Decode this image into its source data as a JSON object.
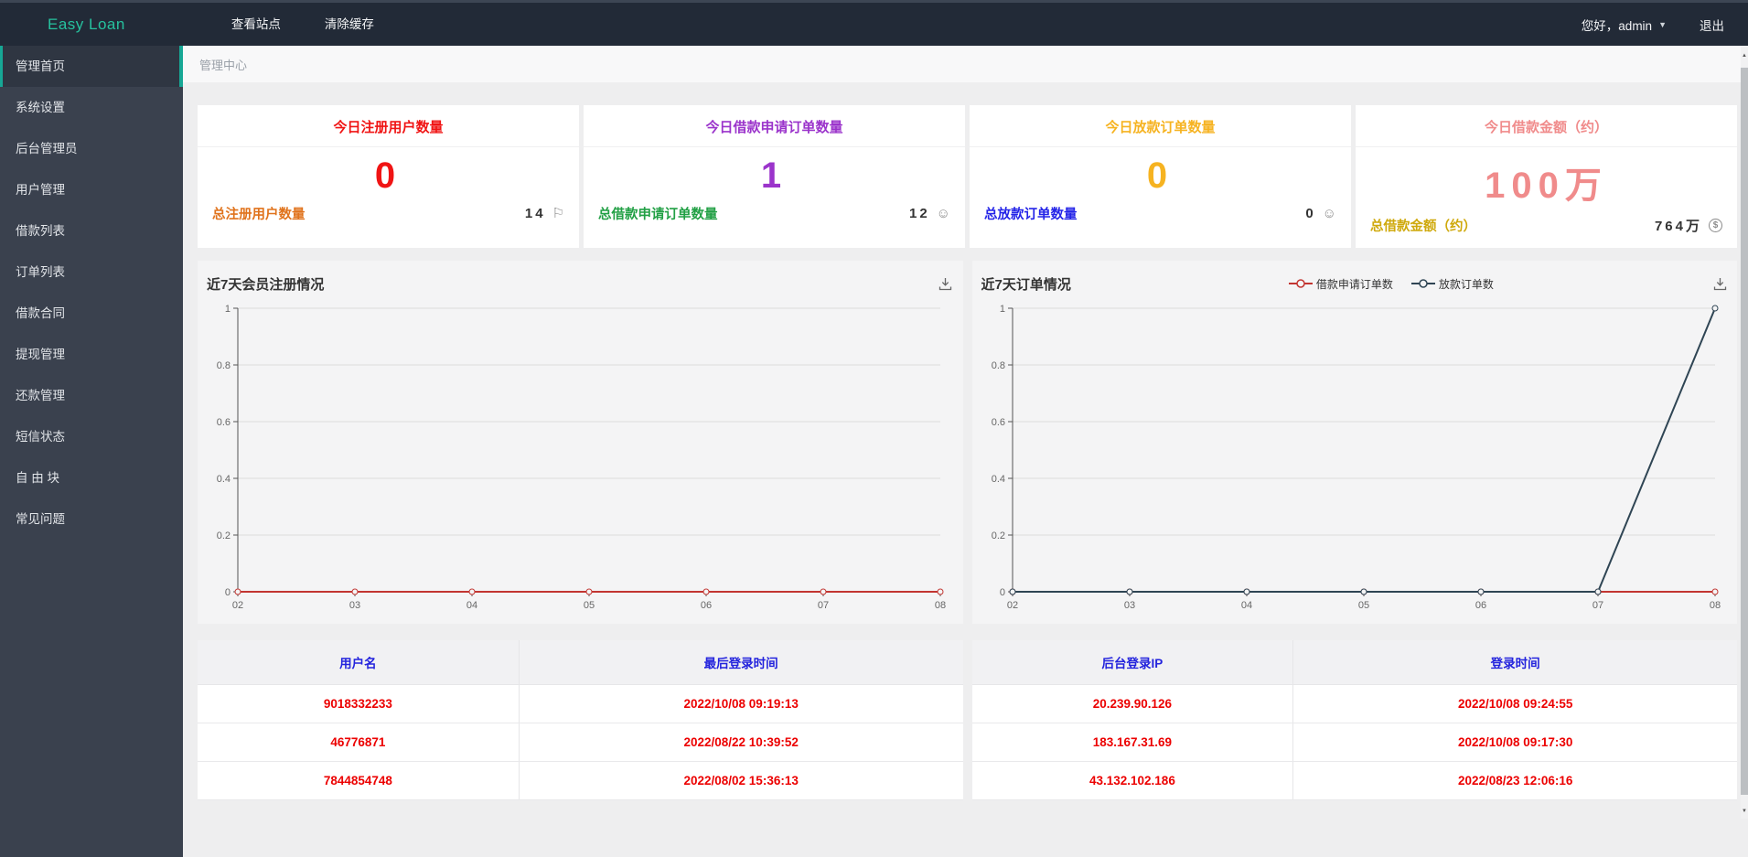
{
  "navbar": {
    "brand": "Easy Loan",
    "items": [
      {
        "label": "查看站点"
      },
      {
        "label": "清除缓存"
      }
    ],
    "greeting": "您好，admin",
    "logout": "退出"
  },
  "sidebar": {
    "items": [
      {
        "label": "管理首页",
        "active": true
      },
      {
        "label": "系统设置",
        "active": false
      },
      {
        "label": "后台管理员",
        "active": false
      },
      {
        "label": "用户管理",
        "active": false
      },
      {
        "label": "借款列表",
        "active": false
      },
      {
        "label": "订单列表",
        "active": false
      },
      {
        "label": "借款合同",
        "active": false
      },
      {
        "label": "提现管理",
        "active": false
      },
      {
        "label": "还款管理",
        "active": false
      },
      {
        "label": "短信状态",
        "active": false
      },
      {
        "label": "自 由 块",
        "active": false
      },
      {
        "label": "常见问题",
        "active": false
      }
    ]
  },
  "breadcrumb": "管理中心",
  "cards": [
    {
      "title": "今日注册用户数量",
      "color": "#f01414",
      "value": "0",
      "footer_label": "总注册用户数量",
      "footer_label_color": "#e0731c",
      "footer_value": "14",
      "footer_icon": "flag"
    },
    {
      "title": "今日借款申请订单数量",
      "color": "#9b34cb",
      "value": "1",
      "footer_label": "总借款申请订单数量",
      "footer_label_color": "#22a045",
      "footer_value": "12",
      "footer_icon": "smiley"
    },
    {
      "title": "今日放款订单数量",
      "color": "#f6b321",
      "value": "0",
      "footer_label": "总放款订单数量",
      "footer_label_color": "#2424e8",
      "footer_value": "0",
      "footer_icon": "smiley"
    },
    {
      "title": "今日借款金额（约）",
      "color": "#f08b8b",
      "value": "100万",
      "footer_label": "总借款金额（约）",
      "footer_label_color": "#cfa90c",
      "footer_value": "764万",
      "footer_icon": "dollar"
    }
  ],
  "chart_data": [
    {
      "type": "line",
      "title": "近7天会员注册情况",
      "categories": [
        "02",
        "03",
        "04",
        "05",
        "06",
        "07",
        "08"
      ],
      "series": [
        {
          "color": "#c23531",
          "values": [
            0,
            0,
            0,
            0,
            0,
            0,
            0
          ]
        }
      ],
      "xlabel": "",
      "ylabel": "",
      "ylim": [
        0,
        1
      ],
      "yticks": [
        0,
        0.2,
        0.4,
        0.6,
        0.8,
        1
      ],
      "grid": true,
      "legend_visible": false,
      "legend_position": "top-center"
    },
    {
      "type": "line",
      "title": "近7天订单情况",
      "categories": [
        "02",
        "03",
        "04",
        "05",
        "06",
        "07",
        "08"
      ],
      "series": [
        {
          "name": "借款申请订单数",
          "color": "#c23531",
          "values": [
            0,
            0,
            0,
            0,
            0,
            0,
            0
          ]
        },
        {
          "name": "放款订单数",
          "color": "#2f4554",
          "values": [
            0,
            0,
            0,
            0,
            0,
            0,
            1
          ]
        }
      ],
      "xlabel": "",
      "ylabel": "",
      "ylim": [
        0,
        1
      ],
      "yticks": [
        0,
        0.2,
        0.4,
        0.6,
        0.8,
        1
      ],
      "grid": true,
      "legend_visible": true,
      "legend_position": "top-center"
    }
  ],
  "tables": [
    {
      "headers": [
        "用户名",
        "最后登录时间"
      ],
      "rows": [
        [
          "9018332233",
          "2022/10/08 09:19:13"
        ],
        [
          "46776871",
          "2022/08/22 10:39:52"
        ],
        [
          "7844854748",
          "2022/08/02 15:36:13"
        ]
      ]
    },
    {
      "headers": [
        "后台登录IP",
        "登录时间"
      ],
      "rows": [
        [
          "20.239.90.126",
          "2022/10/08 09:24:55"
        ],
        [
          "183.167.31.69",
          "2022/10/08 09:17:30"
        ],
        [
          "43.132.102.186",
          "2022/08/23 12:06:16"
        ]
      ]
    }
  ],
  "colors": {
    "brand_teal": "#17a795",
    "navbar_bg": "#222a37",
    "sidebar_bg": "#3a414e",
    "series_red": "#c23531",
    "series_navy": "#2f4554",
    "table_header_text": "#2323dd",
    "table_cell_text": "#ec0000"
  }
}
